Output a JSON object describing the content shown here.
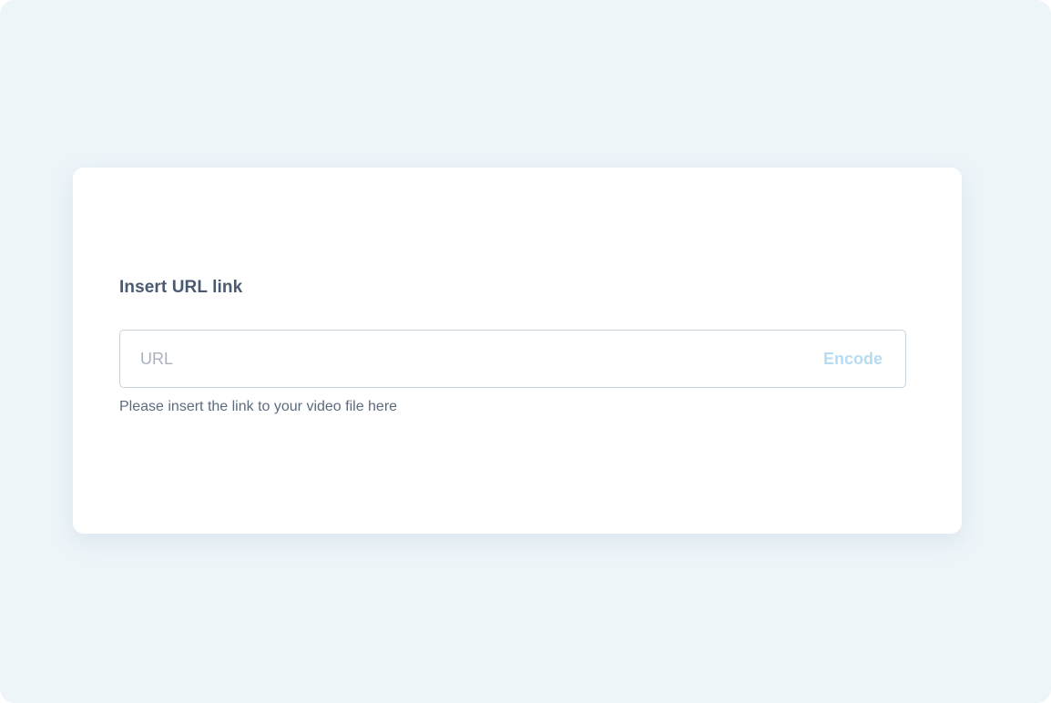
{
  "form": {
    "label": "Insert URL link",
    "url_placeholder": "URL",
    "url_value": "",
    "encode_label": "Encode",
    "helper_text": "Please insert the link to your video file here"
  },
  "colors": {
    "background": "#edf5f9",
    "card": "#ffffff",
    "label_text": "#4a5a70",
    "placeholder_text": "#a8b2bd",
    "encode_button_disabled": "#b5dcf3",
    "input_border": "#c9d3db",
    "helper_text": "#5d6b7e"
  }
}
